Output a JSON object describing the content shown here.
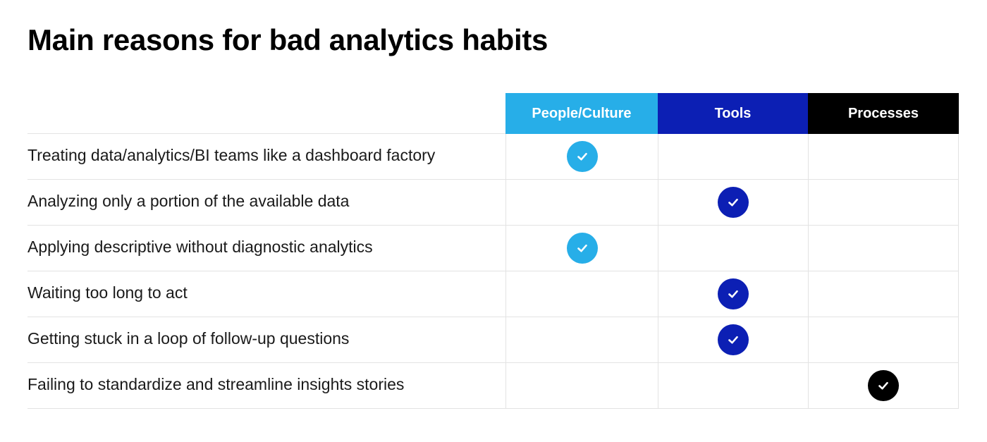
{
  "title": "Main reasons for bad analytics habits",
  "columns": [
    {
      "label": "People/Culture",
      "color": "#27aee8"
    },
    {
      "label": "Tools",
      "color": "#0c1fb4"
    },
    {
      "label": "Processes",
      "color": "#000000"
    }
  ],
  "rows": [
    {
      "label": "Treating data/analytics/BI teams like a dashboard factory",
      "checks": [
        true,
        false,
        false
      ]
    },
    {
      "label": "Analyzing only a portion of the available data",
      "checks": [
        false,
        true,
        false
      ]
    },
    {
      "label": "Applying descriptive without diagnostic analytics",
      "checks": [
        true,
        false,
        false
      ]
    },
    {
      "label": "Waiting too long to act",
      "checks": [
        false,
        true,
        false
      ]
    },
    {
      "label": "Getting stuck in a loop of follow-up questions",
      "checks": [
        false,
        true,
        false
      ]
    },
    {
      "label": "Failing to standardize and streamline insights stories",
      "checks": [
        false,
        false,
        true
      ]
    }
  ],
  "icons": {
    "check": "check-circle-icon"
  }
}
